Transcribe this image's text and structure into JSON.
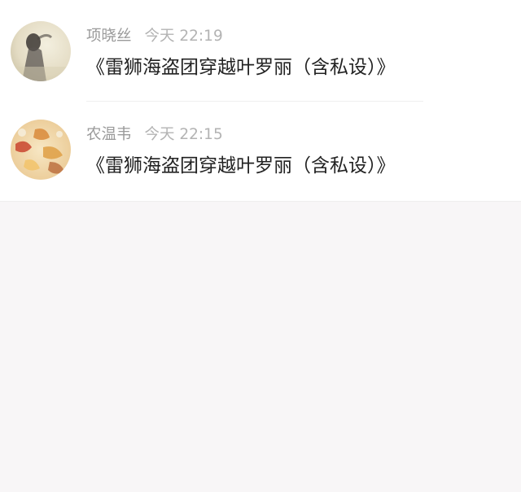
{
  "messages": [
    {
      "user": "项晓丝",
      "time": "今天 22:19",
      "text": "《雷狮海盗团穿越叶罗丽（含私设）》",
      "avatar": "vintage-girl-photo"
    },
    {
      "user": "农温韦",
      "time": "今天 22:15",
      "text": "《雷狮海盗团穿越叶罗丽（含私设）》",
      "avatar": "autumn-leaves-photo"
    }
  ]
}
